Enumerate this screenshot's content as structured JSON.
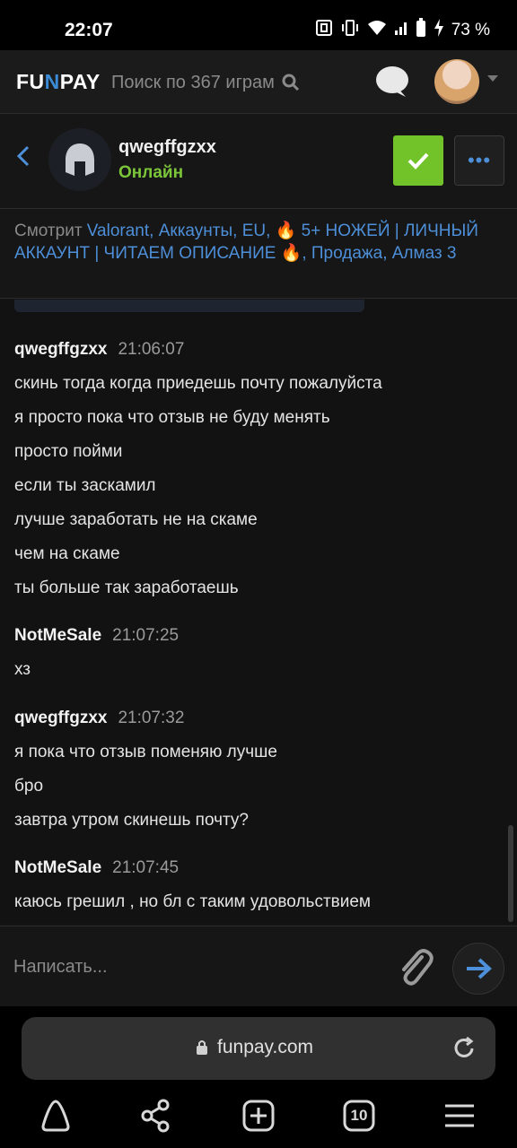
{
  "status": {
    "time": "22:07",
    "battery": "73 %"
  },
  "nav": {
    "logo_left": "FU",
    "logo_mid": "N",
    "logo_right": "PAY",
    "search_placeholder": "Поиск по 367 играм"
  },
  "chat": {
    "username": "qwegffgzxx",
    "status": "Онлайн"
  },
  "watching": {
    "prefix": "Смотрит ",
    "link": "Valorant, Аккаунты, EU, 🔥 5+ НОЖЕЙ | ЛИЧНЫЙ АККАУНТ | ЧИТАЕМ ОПИСАНИЕ 🔥, Продажа, Алмаз 3"
  },
  "messages": [
    {
      "author": "qwegffgzxx",
      "time": "21:06:07",
      "lines": [
        "скинь тогда когда приедешь почту пожалуйста",
        "я просто пока что отзыв не буду менять",
        "просто пойми",
        "если ты заскамил",
        "лучше заработать не на скаме",
        "чем на скаме",
        "ты больше так заработаешь"
      ]
    },
    {
      "author": "NotMeSale",
      "time": "21:07:25",
      "lines": [
        "хз"
      ]
    },
    {
      "author": "qwegffgzxx",
      "time": "21:07:32",
      "lines": [
        "я пока что отзыв поменяю лучше",
        "бро",
        "завтра утром скинешь почту?"
      ]
    },
    {
      "author": "NotMeSale",
      "time": "21:07:45",
      "lines": [
        "каюсь грешил , но бл с таким удовольствием"
      ]
    }
  ],
  "composer": {
    "placeholder": "Написать..."
  },
  "browser": {
    "url": "funpay.com",
    "tabs_count": "10"
  }
}
